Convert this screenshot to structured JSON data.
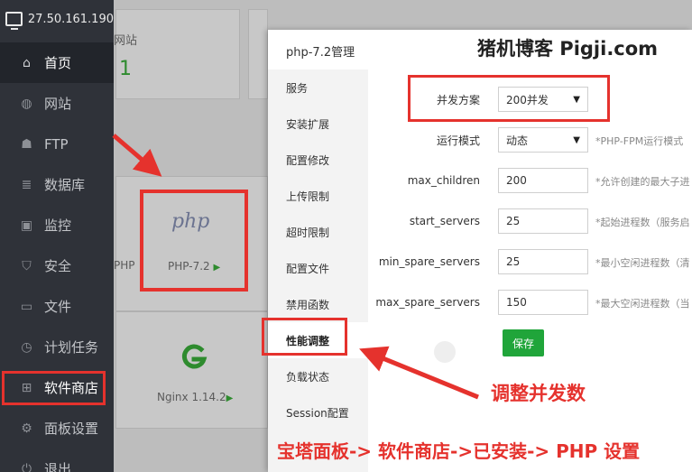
{
  "sidebar": {
    "server_ip": "27.50.161.190",
    "items": [
      {
        "label": "首页",
        "icon": "home-icon"
      },
      {
        "label": "网站",
        "icon": "globe-icon"
      },
      {
        "label": "FTP",
        "icon": "ftp-icon"
      },
      {
        "label": "数据库",
        "icon": "database-icon"
      },
      {
        "label": "监控",
        "icon": "monitor-icon"
      },
      {
        "label": "安全",
        "icon": "shield-icon"
      },
      {
        "label": "文件",
        "icon": "folder-icon"
      },
      {
        "label": "计划任务",
        "icon": "clock-icon"
      },
      {
        "label": "软件商店",
        "icon": "grid-icon"
      },
      {
        "label": "面板设置",
        "icon": "gear-icon"
      },
      {
        "label": "退出",
        "icon": "logout-icon"
      }
    ]
  },
  "background": {
    "card_label": "网站",
    "card_count": "1",
    "php_cut": "PHP",
    "php_app": "PHP-7.2",
    "nginx_app": "Nginx 1.14.2"
  },
  "modal": {
    "title": "php-7.2管理",
    "watermark": "猪机博客 Pigji.com",
    "menu": [
      "服务",
      "安装扩展",
      "配置修改",
      "上传限制",
      "超时限制",
      "配置文件",
      "禁用函数",
      "性能调整",
      "负载状态",
      "Session配置"
    ],
    "active_menu": "性能调整",
    "form": {
      "concurrency": {
        "label": "并发方案",
        "value": "200并发"
      },
      "run_mode": {
        "label": "运行模式",
        "value": "动态",
        "hint": "*PHP-FPM运行模式"
      },
      "max_children": {
        "label": "max_children",
        "value": "200",
        "hint": "*允许创建的最大子进"
      },
      "start_servers": {
        "label": "start_servers",
        "value": "25",
        "hint": "*起始进程数（服务启"
      },
      "min_spare_servers": {
        "label": "min_spare_servers",
        "value": "25",
        "hint": "*最小空闲进程数（清"
      },
      "max_spare_servers": {
        "label": "max_spare_servers",
        "value": "150",
        "hint": "*最大空闲进程数（当"
      }
    },
    "save_label": "保存"
  },
  "annotations": {
    "adjust": "调整并发数",
    "path": "宝塔面板-> 软件商店->已安装-> PHP 设置"
  },
  "colors": {
    "highlight": "#e5322d",
    "accent_green": "#20a53a",
    "sidebar_bg": "#2f3239"
  }
}
